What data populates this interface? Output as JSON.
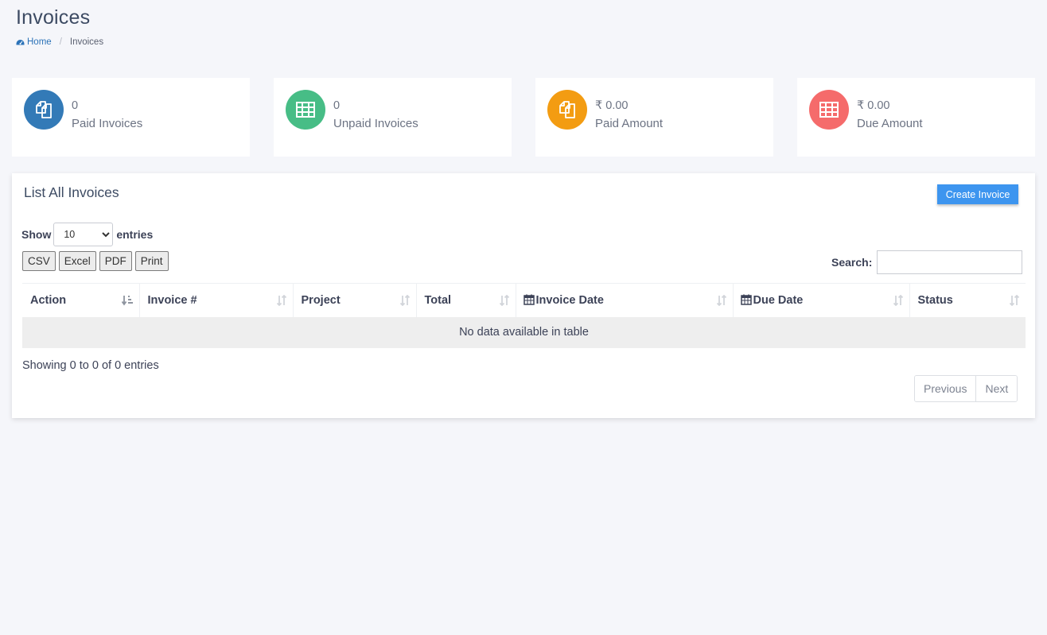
{
  "page": {
    "title": "Invoices"
  },
  "breadcrumb": {
    "home": "Home",
    "current": "Invoices"
  },
  "stats": [
    {
      "value": "0",
      "label": "Paid Invoices",
      "color": "#337ab7",
      "icon": "copy-icon"
    },
    {
      "value": "0",
      "label": "Unpaid Invoices",
      "color": "#47bd86",
      "icon": "table-icon"
    },
    {
      "value": "₹ 0.00",
      "label": "Paid Amount",
      "color": "#f39c12",
      "icon": "copy-icon"
    },
    {
      "value": "₹ 0.00",
      "label": "Due Amount",
      "color": "#f56b6b",
      "icon": "table-icon"
    }
  ],
  "panel": {
    "title": "List All Invoices",
    "create_label": "Create Invoice"
  },
  "length": {
    "show_label": "Show",
    "selected": "10",
    "entries_label": "entries"
  },
  "export": {
    "csv": "CSV",
    "excel": "Excel",
    "pdf": "PDF",
    "print": "Print"
  },
  "search": {
    "label": "Search:"
  },
  "table": {
    "columns": [
      "Action",
      "Invoice #",
      "Project",
      "Total",
      "Invoice Date",
      "Due Date",
      "Status"
    ],
    "empty": "No data available in table"
  },
  "footer": {
    "info": "Showing 0 to 0 of 0 entries",
    "prev": "Previous",
    "next": "Next"
  },
  "colors": {
    "accent": "#3d95ef",
    "background": "#f5f6fa"
  }
}
